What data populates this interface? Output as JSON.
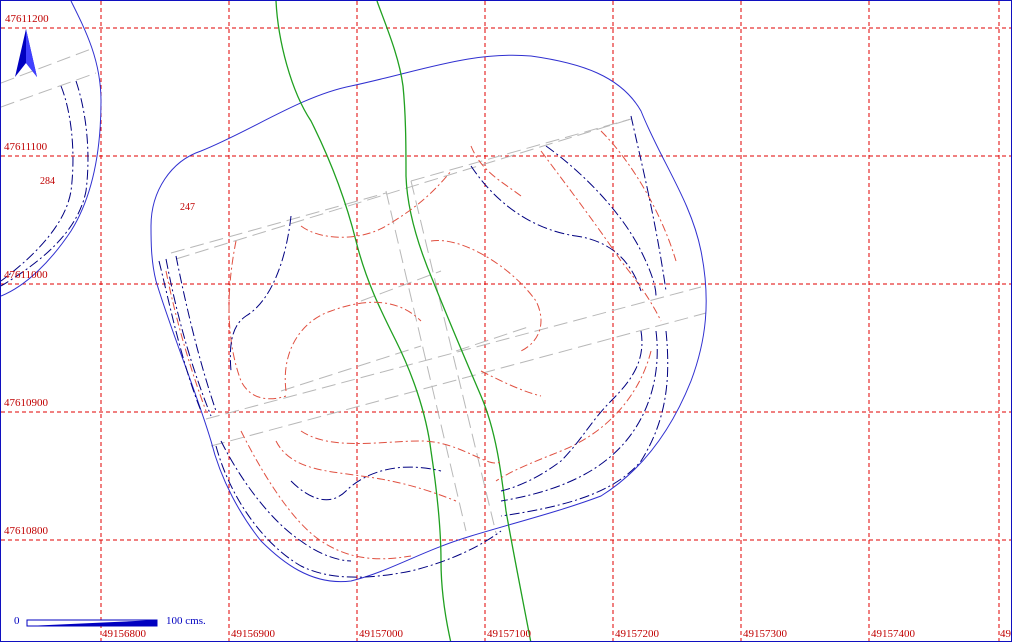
{
  "map": {
    "background": "#ffffff",
    "grid_color": "#e00000",
    "label_color": "#c00000",
    "boundary_color": "#3030d0",
    "road_color": "#20a020",
    "contour_red": "#e05040",
    "contour_blue": "#000080",
    "strip_color": "#b8b8b8",
    "x_labels": [
      "49156800",
      "49156900",
      "49157000",
      "49157100",
      "49157200",
      "49157300",
      "49157400",
      "49"
    ],
    "y_labels": [
      "47611200",
      "47611100",
      "47611000",
      "47610900",
      "47610800"
    ],
    "elevation_labels": [
      "284",
      "247"
    ],
    "north_arrow_icon": "north-arrow-icon"
  },
  "scale_bar": {
    "start_label": "0",
    "end_label": "100 cms.",
    "color": "#0000c0"
  }
}
